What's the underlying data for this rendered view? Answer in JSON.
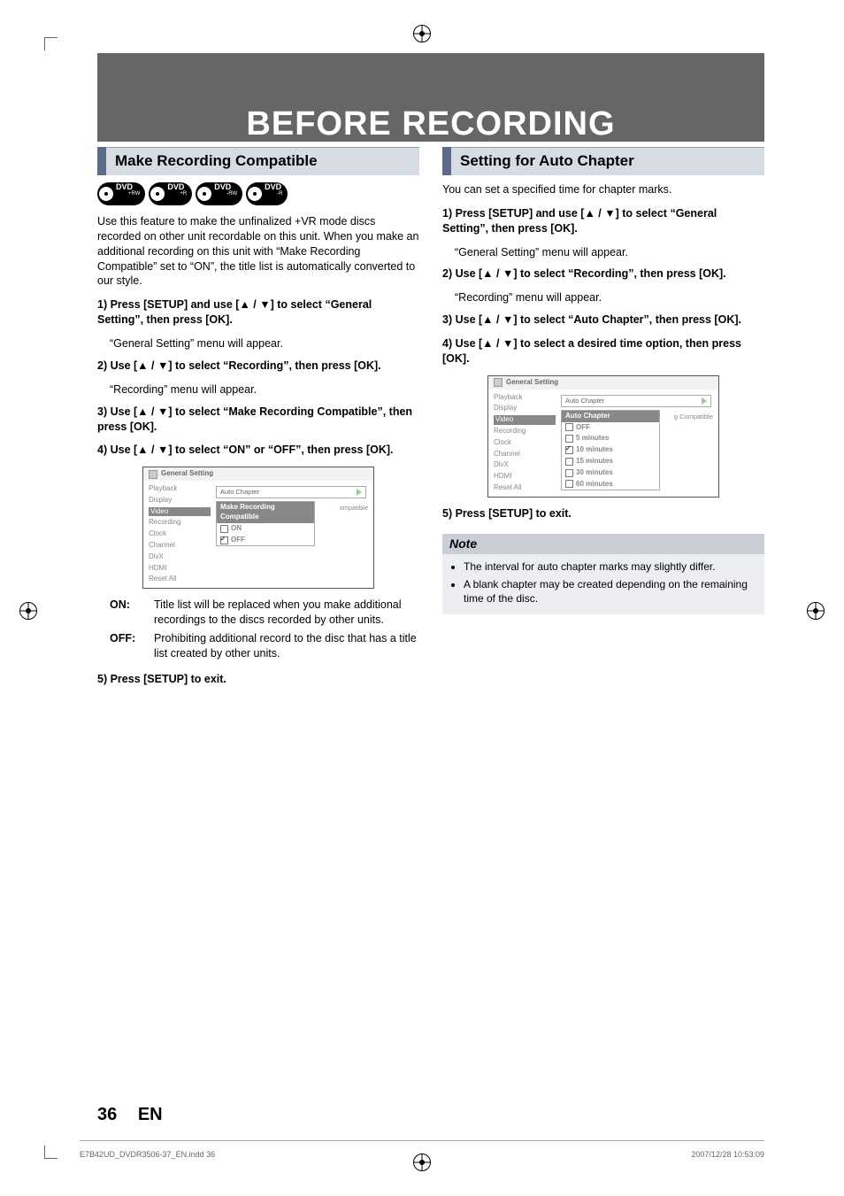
{
  "title": "BEFORE RECORDING",
  "left": {
    "heading": "Make Recording Compatible",
    "discs": [
      "DVD +RW",
      "DVD +R",
      "DVD -RW",
      "DVD -R"
    ],
    "intro": "Use this feature to make the unfinalized +VR mode discs recorded on other unit recordable on this unit. When you make an additional recording on this unit with “Make Recording Compatible” set to “ON”, the title list is automatically converted to our style.",
    "step1": "1) Press [SETUP] and use [▲ / ▼] to select “General Setting”, then press [OK].",
    "step1sub": "“General Setting” menu will appear.",
    "step2": "2) Use [▲ / ▼] to select “Recording”, then press [OK].",
    "step2sub": "“Recording” menu will appear.",
    "step3": "3) Use [▲ / ▼] to select “Make Recording Compatible”, then press [OK].",
    "step4": "4) Use [▲ / ▼] to select “ON” or “OFF”, then press [OK].",
    "ui": {
      "title": "General Setting",
      "side": [
        "Playback",
        "Display",
        "Video",
        "Recording",
        "Clock",
        "Channel",
        "DivX",
        "HDMI",
        "Reset All"
      ],
      "side_hi": "Video",
      "field": "Auto Chapter",
      "popup_title": "Make Recording Compatible",
      "opts": [
        "ON",
        "OFF"
      ],
      "opt_checked": "OFF",
      "extra": "ompatible"
    },
    "on_k": "ON:",
    "on_v": "Title list will be replaced when you make additional recordings to the discs recorded by other units.",
    "off_k": "OFF:",
    "off_v": "Prohibiting additional record to the disc that has a title list created by other units.",
    "step5": "5) Press [SETUP] to exit."
  },
  "right": {
    "heading": "Setting for Auto Chapter",
    "intro": "You can set a specified time for chapter marks.",
    "step1": "1) Press [SETUP] and use [▲ / ▼] to select “General Setting”, then press [OK].",
    "step1sub": "“General Setting” menu will appear.",
    "step2": "2) Use [▲ / ▼] to select “Recording”, then press [OK].",
    "step2sub": "“Recording” menu will appear.",
    "step3": "3) Use [▲ / ▼] to select “Auto Chapter”, then press [OK].",
    "step4": "4) Use [▲ / ▼] to select a desired time option, then press [OK].",
    "ui": {
      "title": "General Setting",
      "side": [
        "Playback",
        "Display",
        "Video",
        "Recording",
        "Clock",
        "Channel",
        "DivX",
        "HDMI",
        "Reset All"
      ],
      "side_hi": "Video",
      "field": "Auto Chapter",
      "popup_title": "Auto Chapter",
      "opts": [
        "OFF",
        "5 minutes",
        "10 minutes",
        "15 minutes",
        "30 minutes",
        "60 minutes"
      ],
      "opt_checked": "10 minutes",
      "extra": "g Compatible"
    },
    "step5": "5) Press [SETUP] to exit.",
    "note_title": "Note",
    "note1": "The interval for auto chapter marks may slightly differ.",
    "note2": "A blank chapter may be created depending on the remaining time of the disc."
  },
  "page_number": "36",
  "page_lang": "EN",
  "footer_file": "E7B42UD_DVDR3506-37_EN.indd   36",
  "footer_time": "2007/12/28   10:53:09"
}
